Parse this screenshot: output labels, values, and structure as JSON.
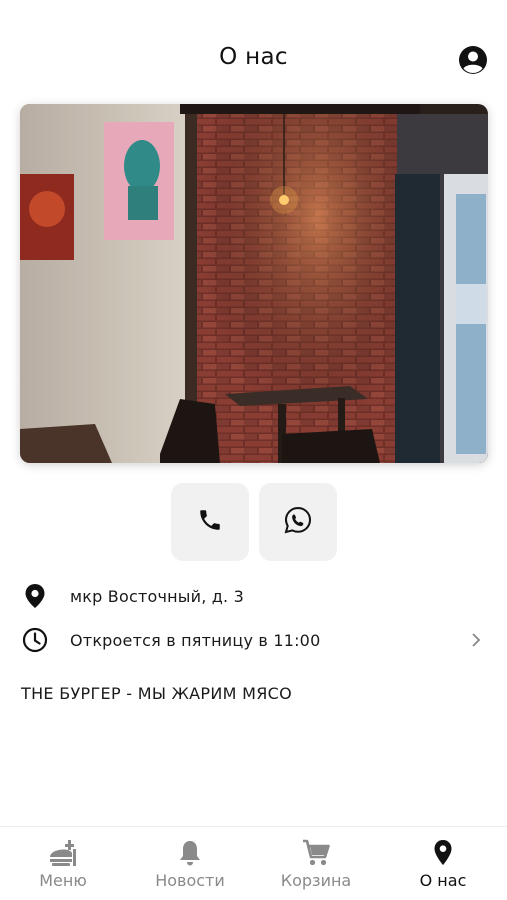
{
  "header": {
    "title": "О нас",
    "profile_icon": "account-circle-icon"
  },
  "photo": {
    "subject": "cafe-interior-photo"
  },
  "contacts": {
    "phone_icon": "phone-icon",
    "whatsapp_icon": "whatsapp-icon"
  },
  "info": {
    "address": "мкр Восточный, д. 3",
    "hours": "Откроется в пятницу в 11:00"
  },
  "slogan": "THE БУРГЕР - МЫ ЖАРИМ МЯСО",
  "tabs": [
    {
      "label": "Меню",
      "icon": "food-icon",
      "active": false
    },
    {
      "label": "Новости",
      "icon": "bell-icon",
      "active": false
    },
    {
      "label": "Корзина",
      "icon": "cart-icon",
      "active": false
    },
    {
      "label": "О нас",
      "icon": "location-pin-icon",
      "active": true
    }
  ],
  "colors": {
    "active": "#111111",
    "inactive": "#8a8a8a",
    "button_bg": "#f1f1f1"
  }
}
